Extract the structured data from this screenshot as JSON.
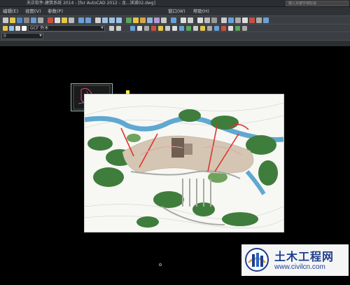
{
  "titlebar": {
    "title": "天正软件-建筑系统 2014 - [for AutoCAD 2012 - 龙...滨湖02.dwg]",
    "search_placeholder": "键入关键字或短语"
  },
  "menu": [
    {
      "label": "编辑(E)"
    },
    {
      "label": "视图(V)"
    },
    {
      "label": "参数(P)"
    },
    {
      "label": "窗口(W)"
    },
    {
      "label": "帮助(H)"
    }
  ],
  "toolbar": {
    "layer_combo": "0",
    "textstyle_combo": "GCF 乔木",
    "colors": {
      "accent_blue": "#4d86c9",
      "accent_yellow": "#e4c64a",
      "accent_green": "#5aa55a",
      "accent_red": "#c9503f"
    }
  },
  "watermark": {
    "title": "土木工程网",
    "url": "www.civilcn.com"
  }
}
